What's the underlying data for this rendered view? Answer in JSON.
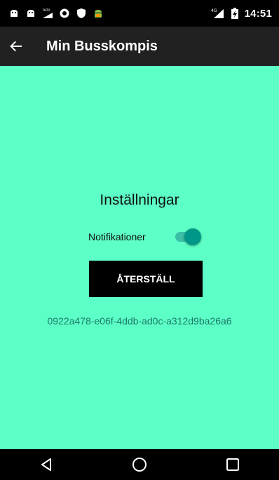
{
  "status_bar": {
    "time": "14:51",
    "network": "4G",
    "data_label": "DATA",
    "icons": [
      "android-icon",
      "android-icon",
      "data-signal-icon",
      "circle-app-icon",
      "shield-icon",
      "android-robot-icon"
    ]
  },
  "app_bar": {
    "title": "Min Busskompis",
    "back_icon": "arrow-back-icon"
  },
  "settings": {
    "title": "Inställningar",
    "notifications_label": "Notifikationer",
    "notifications_enabled": true,
    "reset_label": "ÅTERSTÄLL",
    "device_id": "0922a478-e06f-4ddb-ad0c-a312d9ba26a6"
  },
  "nav_bar": {
    "icons": [
      "back-triangle-icon",
      "home-circle-icon",
      "recents-square-icon"
    ]
  },
  "colors": {
    "background": "#5cffc5",
    "app_bar": "#212121",
    "switch_accent": "#009688",
    "device_id_text": "#1c7a6a"
  }
}
